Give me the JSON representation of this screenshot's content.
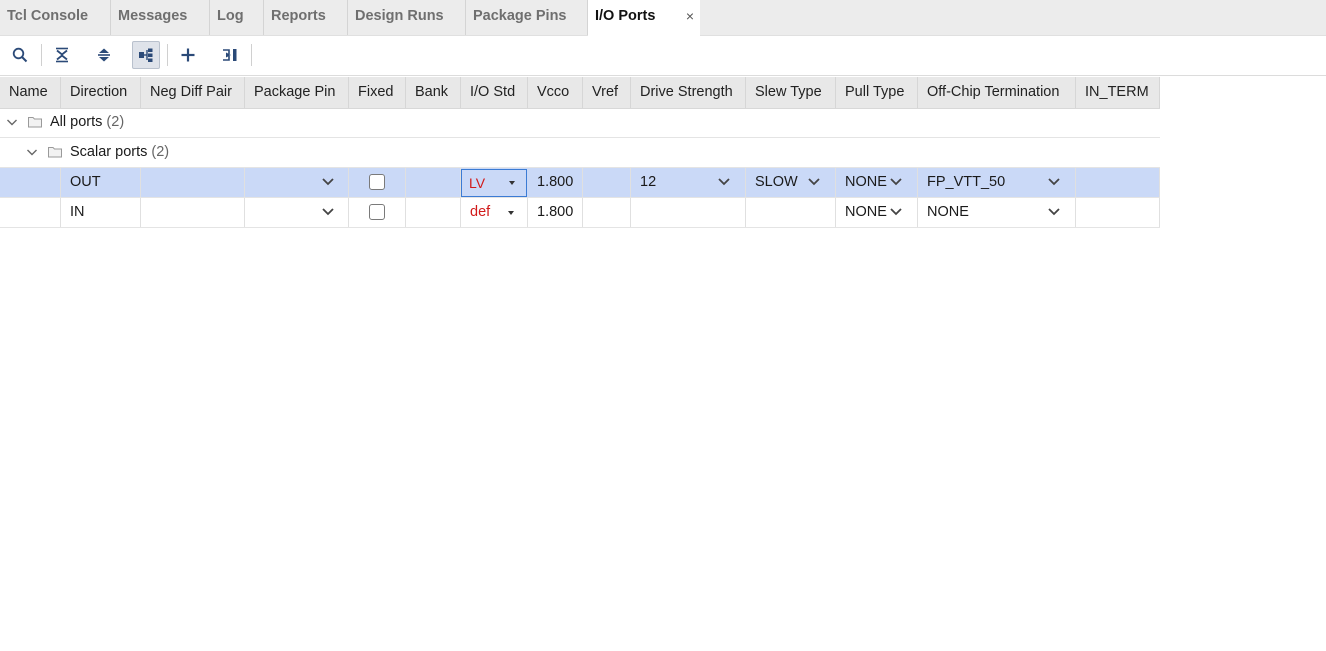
{
  "tabs": [
    {
      "label": "Tcl Console"
    },
    {
      "label": "Messages"
    },
    {
      "label": "Log"
    },
    {
      "label": "Reports"
    },
    {
      "label": "Design Runs"
    },
    {
      "label": "Package Pins"
    },
    {
      "label": "I/O Ports",
      "active": true,
      "close": "×"
    }
  ],
  "toolbar": {
    "buttons": [
      "search-icon",
      "collapse-all-icon",
      "expand-all-icon",
      "group-by-interface-icon",
      "add-icon",
      "auto-assign-icon"
    ],
    "pressed": "group-by-interface-icon"
  },
  "columns": [
    "Name",
    "Direction",
    "Neg Diff Pair",
    "Package Pin",
    "Fixed",
    "Bank",
    "I/O Std",
    "Vcco",
    "Vref",
    "Drive Strength",
    "Slew Type",
    "Pull Type",
    "Off-Chip Termination",
    "IN_TERM"
  ],
  "tree": {
    "all_ports": {
      "label": "All ports",
      "count": "(2)"
    },
    "scalar_ports": {
      "label": "Scalar ports",
      "count": "(2)"
    }
  },
  "ports": [
    {
      "name": "OUT",
      "direction": "",
      "neg_diff_pair": "",
      "package_pin": "",
      "fixed": false,
      "bank": "",
      "io_std": "LV",
      "vcco": "1.800",
      "vref": "",
      "drive_strength": "12",
      "slew_type": "SLOW",
      "pull_type": "NONE",
      "off_chip_termination": "FP_VTT_50",
      "in_term": "",
      "selected": true
    },
    {
      "name": "IN",
      "direction": "",
      "neg_diff_pair": "",
      "package_pin": "",
      "fixed": false,
      "bank": "",
      "io_std": "def",
      "vcco": "1.800",
      "vref": "",
      "drive_strength": "",
      "slew_type": "",
      "pull_type": "NONE",
      "off_chip_termination": "NONE",
      "in_term": "",
      "selected": false
    }
  ],
  "colors": {
    "selection": "#cad9f7",
    "error_text": "#d11a1a",
    "focus_border": "#3b7bd4",
    "icon": "#2b4a78"
  }
}
